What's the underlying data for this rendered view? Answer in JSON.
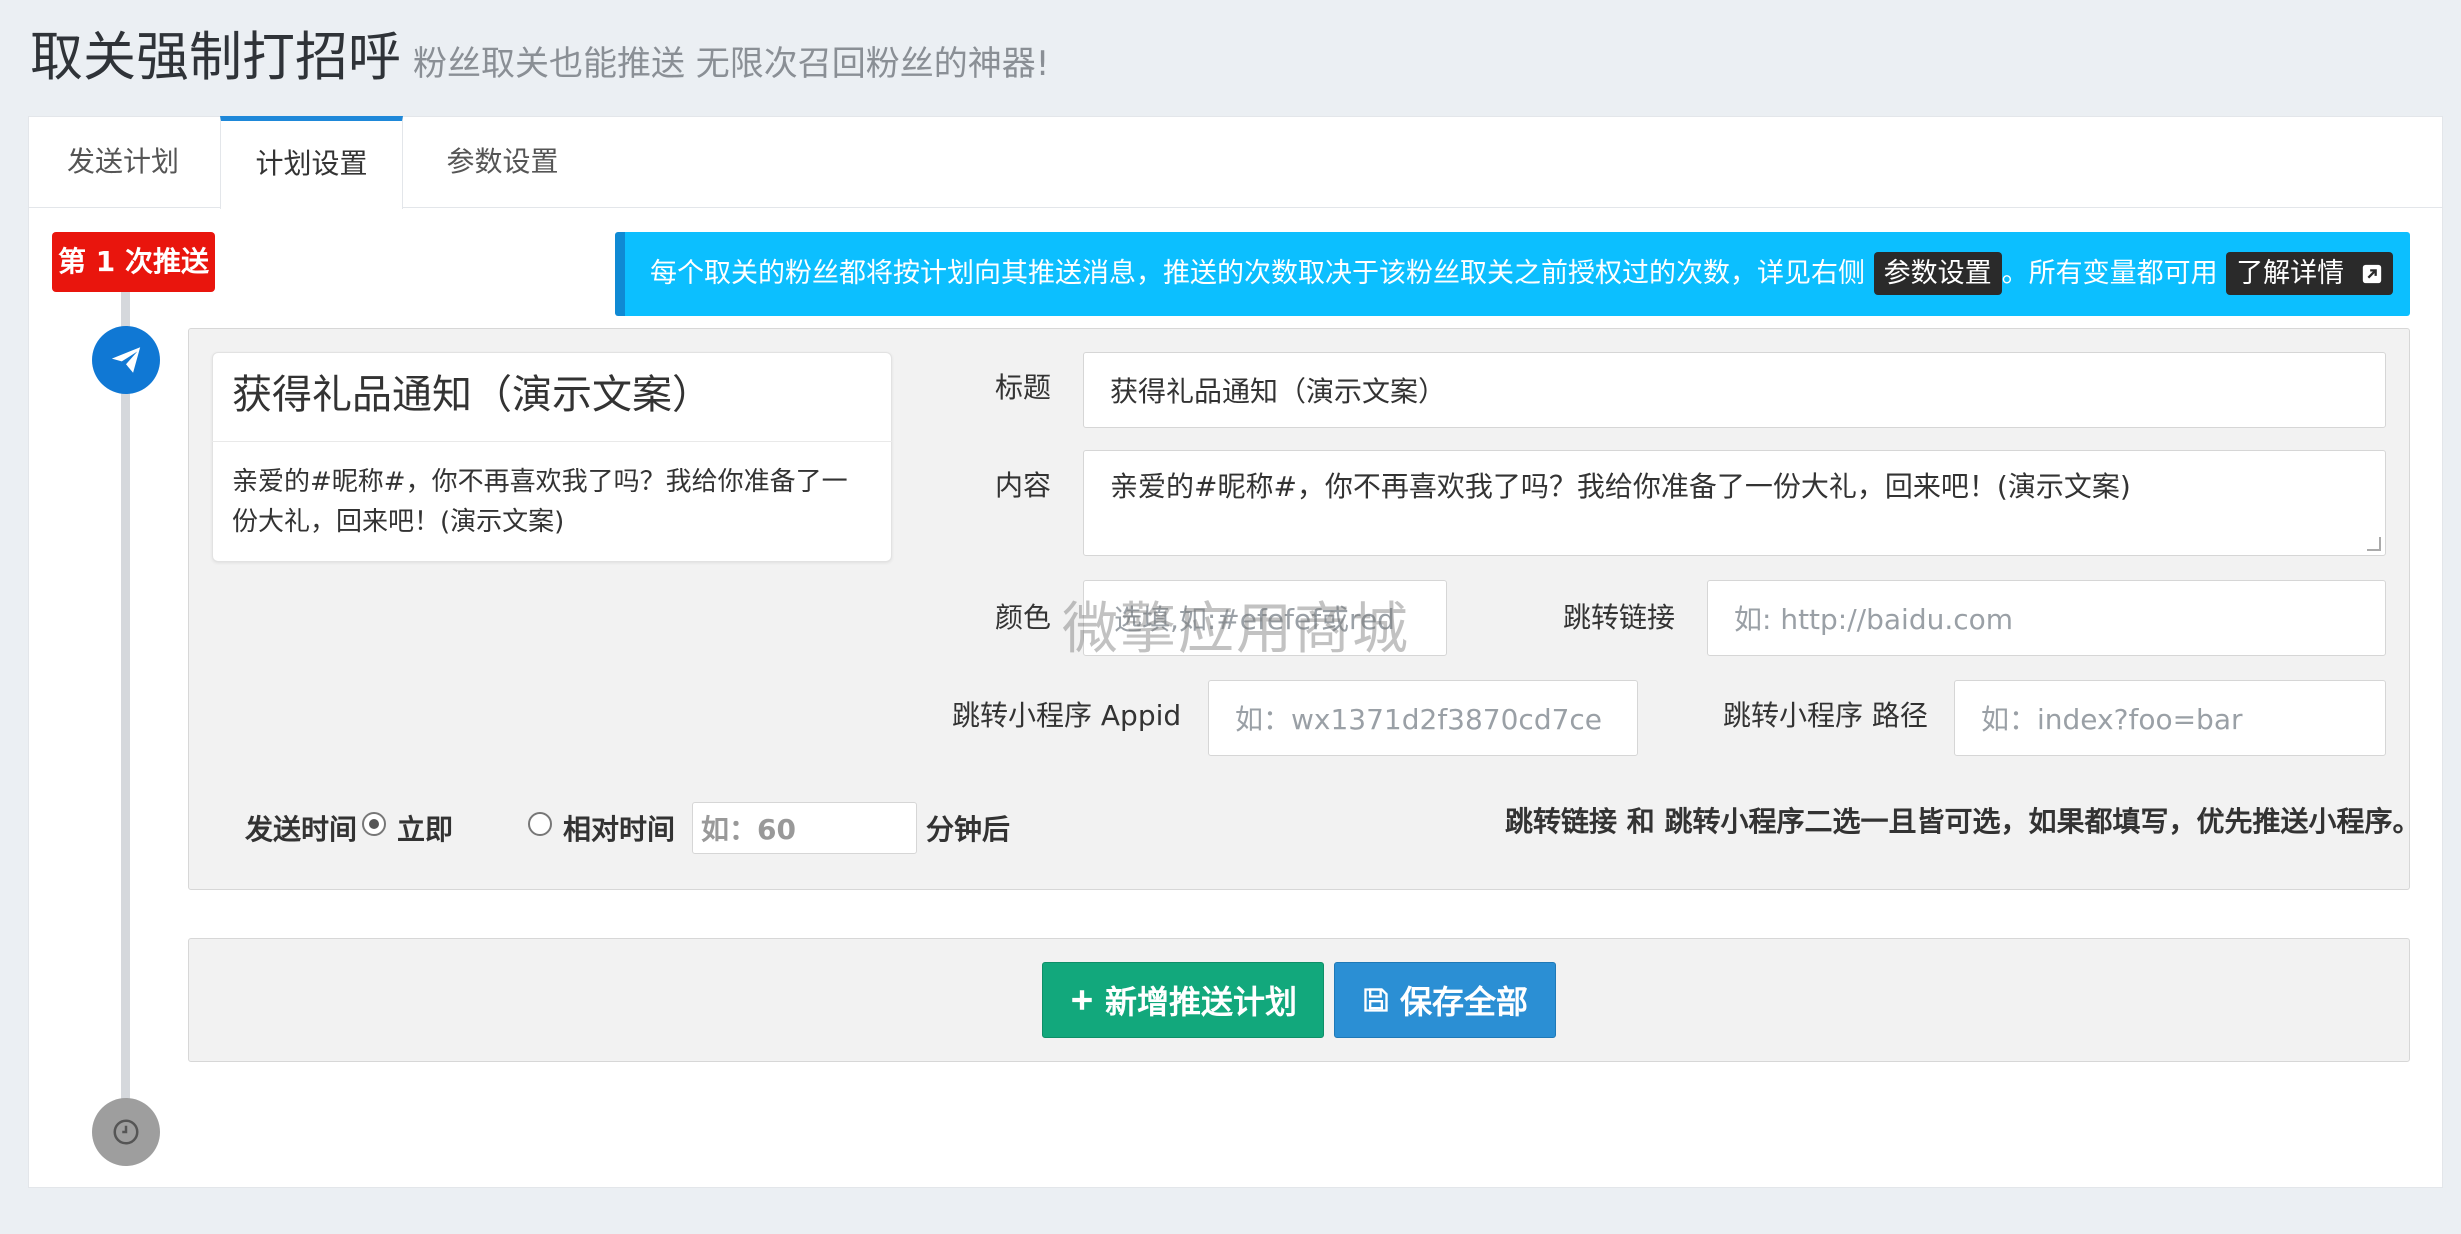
{
  "header": {
    "title": "取关强制打招呼",
    "subtitle": "粉丝取关也能推送 无限次召回粉丝的神器!"
  },
  "tabs": [
    {
      "label": "发送计划",
      "active": false
    },
    {
      "label": "计划设置",
      "active": true
    },
    {
      "label": "参数设置",
      "active": false
    }
  ],
  "timeline": {
    "badge": "第 1 次推送",
    "icons": [
      "paper-plane-icon",
      "clock-icon"
    ],
    "colors": {
      "active": "#1078d4",
      "inactive": "#9e9e9e",
      "badge": "#e9150d"
    }
  },
  "info": {
    "text_before": "每个取关的粉丝都将按计划向其推送消息，推送的次数取决于该粉丝取关之前授权过的次数，详见右侧",
    "params_tag": "参数设置",
    "text_after": "。所有变量都可用",
    "details_button": "了解详情",
    "details_icon": "external-link-icon"
  },
  "preview": {
    "title": "获得礼品通知（演示文案）",
    "body": "亲爱的#昵称#，你不再喜欢我了吗？我给你准备了一份大礼，回来吧！(演示文案)"
  },
  "form": {
    "title_label": "标题",
    "title_value": "获得礼品通知（演示文案）",
    "content_label": "内容",
    "content_value": "亲爱的#昵称#，你不再喜欢我了吗？我给你准备了一份大礼，回来吧！(演示文案)",
    "color_label": "颜色",
    "color_placeholder": "选填,如:#efefef或red",
    "link_label": "跳转链接",
    "link_placeholder": "如:   http://baidu.com",
    "appid_label": "跳转小程序 Appid",
    "appid_placeholder": "如：wx1371d2f3870cd7ce",
    "path_label": "跳转小程序 路径",
    "path_placeholder": "如：index?foo=bar",
    "send_time_label": "发送时间",
    "option_immediate": "立即",
    "option_relative": "相对时间",
    "relative_placeholder": "如：60",
    "minutes_after": "分钟后",
    "note": "跳转链接 和 跳转小程序二选一且皆可选，如果都填写，优先推送小程序。"
  },
  "watermark": "微擎应用商城",
  "actions": {
    "add_label": "新增推送计划",
    "add_icon": "plus-icon",
    "save_label": "保存全部",
    "save_icon": "floppy-disk-icon"
  }
}
